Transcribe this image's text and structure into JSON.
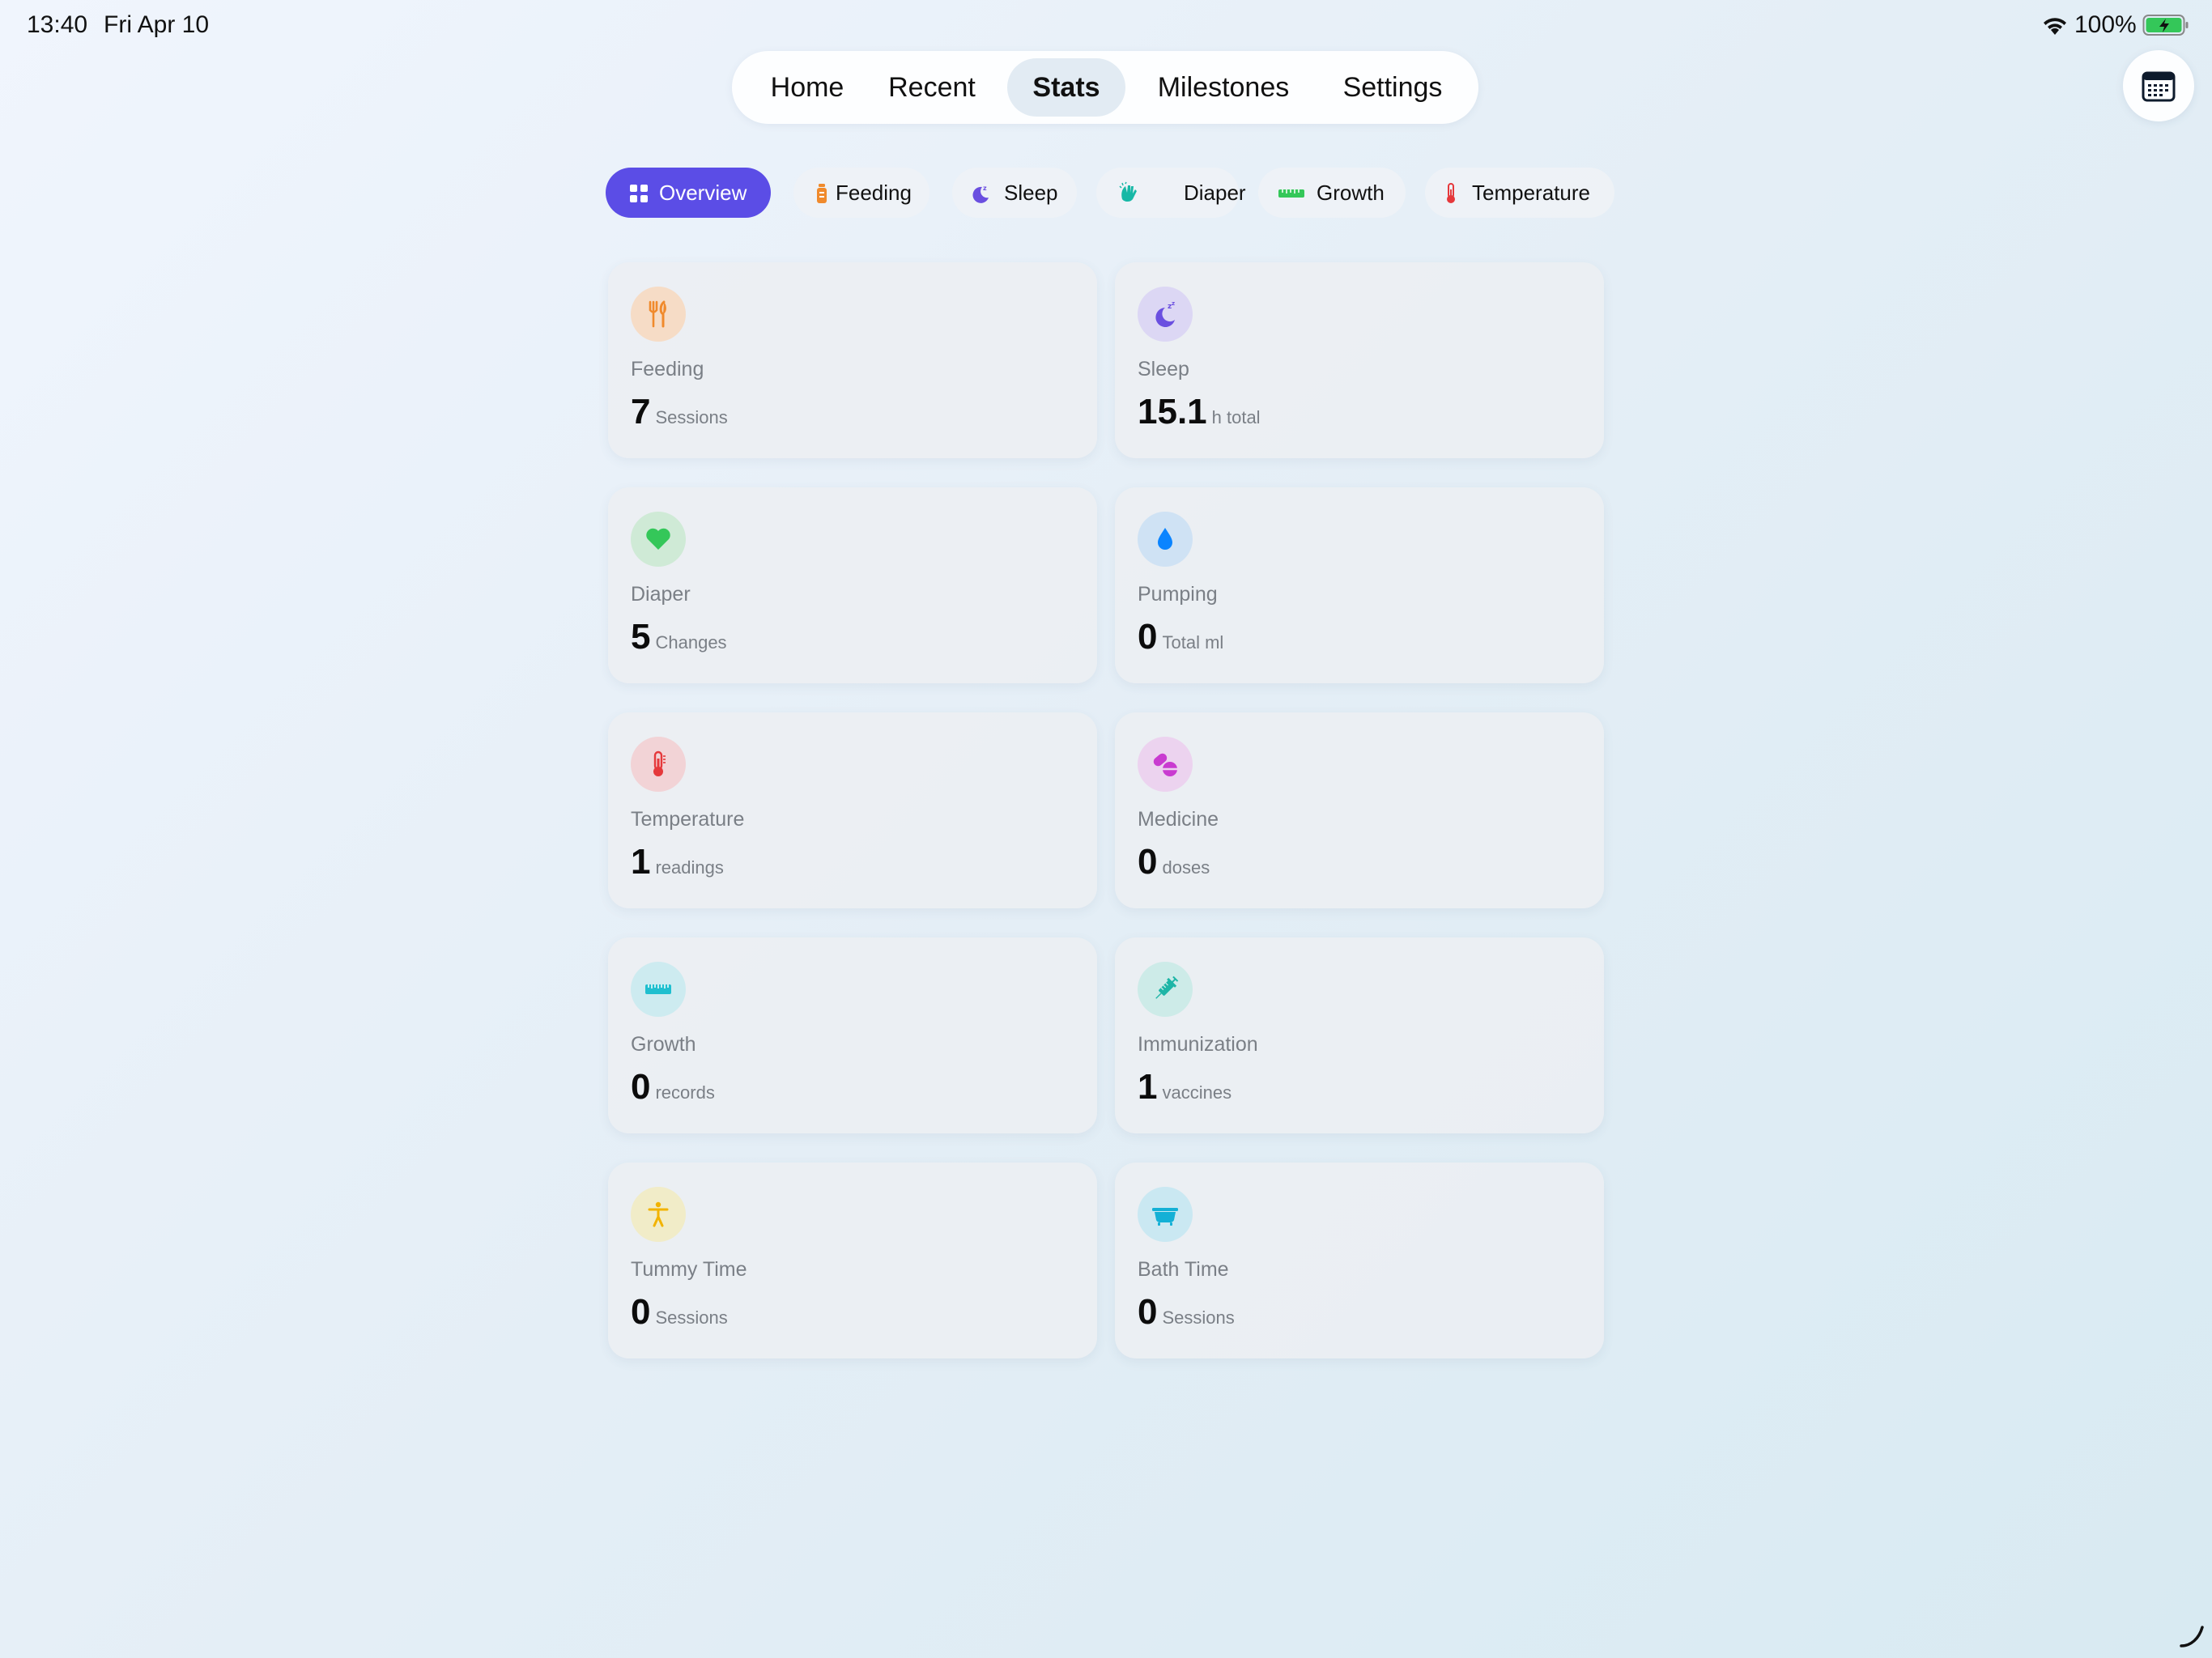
{
  "status_bar": {
    "time": "13:40",
    "date": "Fri Apr 10",
    "battery_percent": "100%"
  },
  "top_tabs": [
    {
      "label": "Home",
      "active": false
    },
    {
      "label": "Recent",
      "active": false
    },
    {
      "label": "Stats",
      "active": true
    },
    {
      "label": "Milestones",
      "active": false
    },
    {
      "label": "Settings",
      "active": false
    }
  ],
  "category_chips": [
    {
      "label": "Overview",
      "icon": "grid-icon",
      "active": true
    },
    {
      "label": "Feeding",
      "icon": "bottle-icon",
      "active": false
    },
    {
      "label": "Sleep",
      "icon": "moon-icon",
      "active": false
    },
    {
      "label": "Diaper",
      "icon": "hands-icon",
      "active": false
    },
    {
      "label": "Growth",
      "icon": "ruler-icon",
      "active": false
    },
    {
      "label": "Temperature",
      "icon": "thermometer-icon",
      "active": false
    }
  ],
  "cards": [
    {
      "title": "Feeding",
      "value": "7",
      "unit": "Sessions",
      "icon": "fork-knife-icon",
      "color": "#f08a2c",
      "bg": "#f6dcc6"
    },
    {
      "title": "Sleep",
      "value": "15.1",
      "unit": "h total",
      "icon": "moon-zzz-icon",
      "color": "#6a4fe0",
      "bg": "#dcd7f4"
    },
    {
      "title": "Diaper",
      "value": "5",
      "unit": "Changes",
      "icon": "heart-icon",
      "color": "#34c759",
      "bg": "#cfead6"
    },
    {
      "title": "Pumping",
      "value": "0",
      "unit": "Total ml",
      "icon": "drop-icon",
      "color": "#0a84ff",
      "bg": "#cfe2f4"
    },
    {
      "title": "Temperature",
      "value": "1",
      "unit": "readings",
      "icon": "thermometer-icon",
      "color": "#e5383b",
      "bg": "#f2d3d6"
    },
    {
      "title": "Medicine",
      "value": "0",
      "unit": "doses",
      "icon": "pills-icon",
      "color": "#c93bd0",
      "bg": "#ecd3ef"
    },
    {
      "title": "Growth",
      "value": "0",
      "unit": "records",
      "icon": "ruler-icon",
      "color": "#1fbfcf",
      "bg": "#cdebf0"
    },
    {
      "title": "Immunization",
      "value": "1",
      "unit": "vaccines",
      "icon": "syringe-icon",
      "color": "#1eb5a6",
      "bg": "#cdebe8"
    },
    {
      "title": "Tummy Time",
      "value": "0",
      "unit": "Sessions",
      "icon": "figure-icon",
      "color": "#f2b300",
      "bg": "#f1ecc8"
    },
    {
      "title": "Bath Time",
      "value": "0",
      "unit": "Sessions",
      "icon": "bathtub-icon",
      "color": "#14b0d6",
      "bg": "#cae8f2"
    }
  ]
}
